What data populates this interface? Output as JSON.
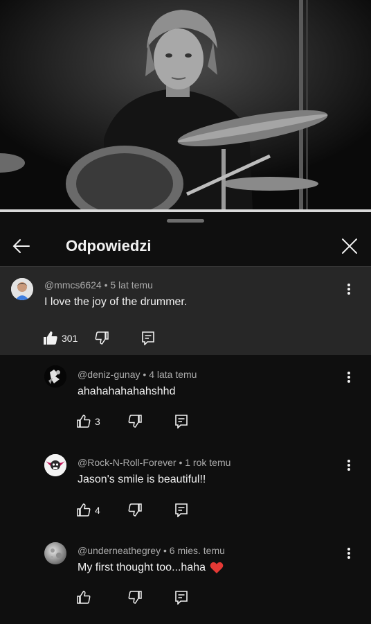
{
  "sheet": {
    "title": "Odpowiedzi"
  },
  "parent": {
    "author": "@mmcs6624",
    "time": "5 lat temu",
    "text": "I love the joy of the drummer.",
    "likes": "301"
  },
  "replies": [
    {
      "author": "@deniz-gunay",
      "time": "4 lata temu",
      "text": "ahahahahahahshhd",
      "likes": "3"
    },
    {
      "author": "@Rock-N-Roll-Forever",
      "time": "1 rok temu",
      "text": "Jason's smile is beautiful!!",
      "likes": "4"
    },
    {
      "author": "@underneathegrey",
      "time": "6 mies. temu",
      "text": "My first thought too...haha",
      "likes": "",
      "emoji": "❤️"
    }
  ],
  "separator": " • ",
  "icons": [
    "back-arrow-icon",
    "close-icon",
    "like-icon",
    "dislike-icon",
    "reply-icon",
    "more-vertical-icon"
  ],
  "colors": {
    "background": "#0f0f0f",
    "highlight": "#272727",
    "text": "#f1f1f1",
    "meta": "#aaaaaa",
    "heart": "#e53935"
  }
}
